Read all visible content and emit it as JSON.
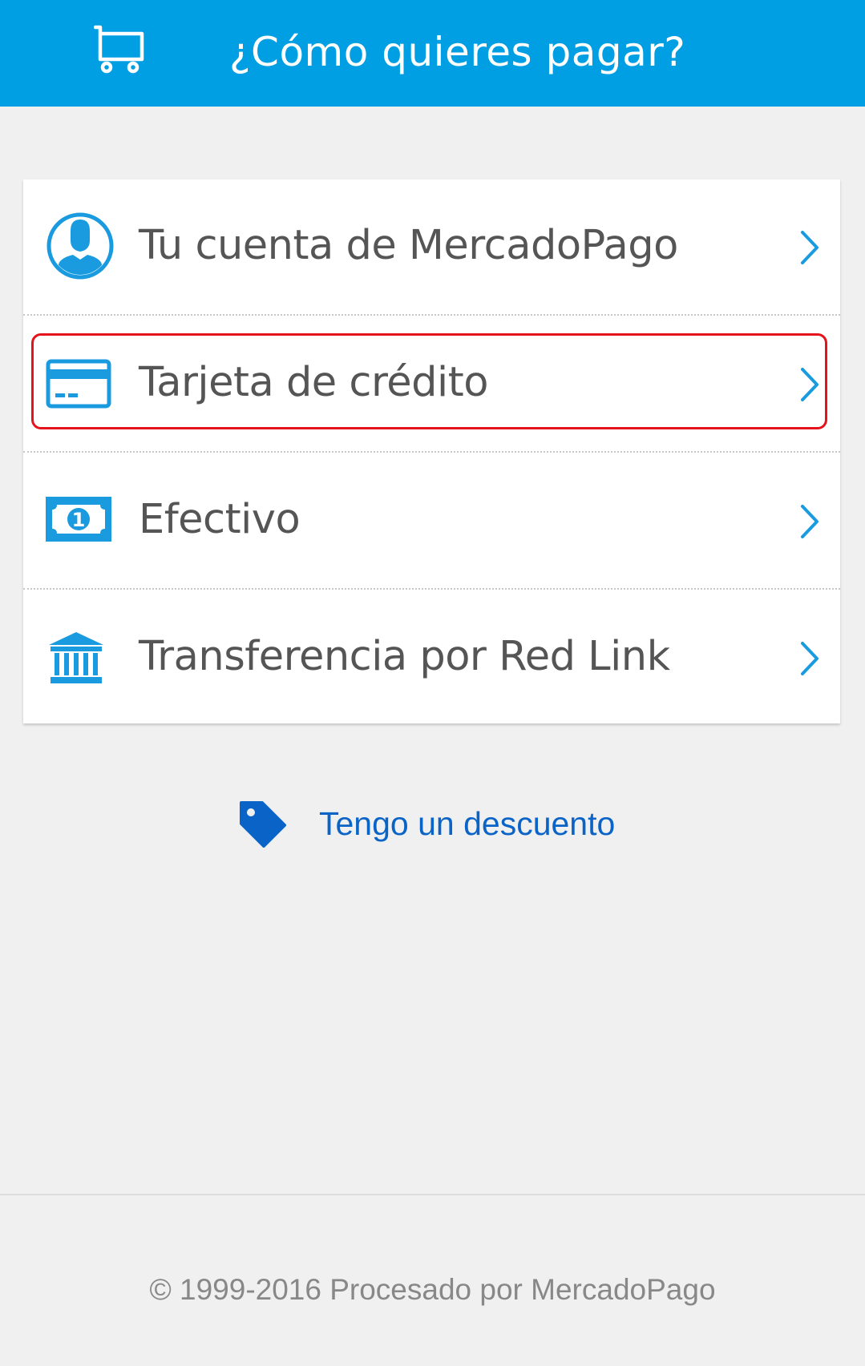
{
  "header": {
    "title": "¿Cómo quieres pagar?",
    "icon": "cart-icon",
    "background_color": "#009ee3"
  },
  "payment_methods": [
    {
      "label": "Tu cuenta de MercadoPago",
      "icon": "user-account-icon"
    },
    {
      "label": "Tarjeta de crédito",
      "icon": "credit-card-icon",
      "highlighted": true
    },
    {
      "label": "Efectivo",
      "icon": "cash-bill-icon"
    },
    {
      "label": "Transferencia por Red Link",
      "icon": "bank-icon"
    }
  ],
  "discount": {
    "label": "Tengo un descuento",
    "icon": "tag-icon"
  },
  "footer": {
    "text": "© 1999-2016 Procesado por MercadoPago"
  },
  "colors": {
    "accent": "#009ee3",
    "link": "#0a64c8",
    "highlight": "#e5131b"
  }
}
